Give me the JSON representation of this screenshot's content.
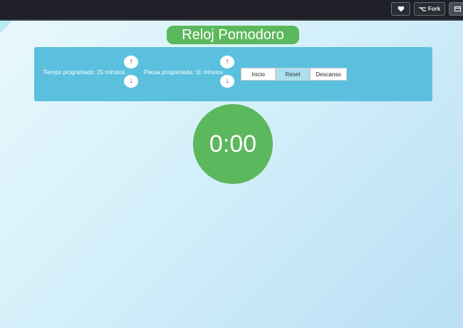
{
  "topbar": {
    "like_icon": "heart-icon",
    "fork_label": "Fork",
    "fork_icon": "fork-icon",
    "view_icon": "layout-icon"
  },
  "app": {
    "title": "Reloj Pomodoro",
    "session_label": "Tiempo programado: 25 minutos",
    "break_label": "Pausa programada: 11 minutos",
    "up_arrow": "↑",
    "down_arrow": "↓",
    "start_label": "Inicio",
    "reset_label": "Reset",
    "break_button_label": "Descanso",
    "clock_display": "0:00"
  },
  "colors": {
    "accent_green": "#5cb85c",
    "panel_blue": "#5bc0de",
    "topbar": "#1f2028"
  }
}
